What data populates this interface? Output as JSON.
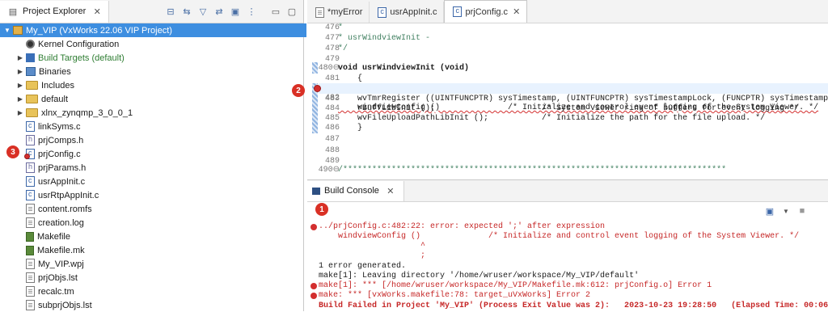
{
  "explorer": {
    "title": "Project Explorer",
    "tree": [
      {
        "label": "My_VIP (VxWorks 22.06 VIP Project)",
        "icon": "project-icon",
        "expanded": true,
        "selected": true
      },
      {
        "label": "Kernel Configuration",
        "icon": "kernel-config-icon"
      },
      {
        "label": "Build Targets (default)",
        "icon": "build-target-icon",
        "green": true
      },
      {
        "label": "Binaries",
        "icon": "binaries-icon"
      },
      {
        "label": "Includes",
        "icon": "includes-icon"
      },
      {
        "label": "default",
        "icon": "folder-icon"
      },
      {
        "label": "xlnx_zynqmp_3_0_0_1",
        "icon": "folder-icon"
      },
      {
        "label": "linkSyms.c",
        "icon": "c-file-icon"
      },
      {
        "label": "prjComps.h",
        "icon": "h-file-icon"
      },
      {
        "label": "prjConfig.c",
        "icon": "c-file-icon",
        "error": true
      },
      {
        "label": "prjParams.h",
        "icon": "h-file-icon"
      },
      {
        "label": "usrAppInit.c",
        "icon": "c-file-icon"
      },
      {
        "label": "usrRtpAppInit.c",
        "icon": "c-file-icon"
      },
      {
        "label": "content.romfs",
        "icon": "file-icon"
      },
      {
        "label": "creation.log",
        "icon": "file-icon"
      },
      {
        "label": "Makefile",
        "icon": "makefile-icon"
      },
      {
        "label": "Makefile.mk",
        "icon": "makefile-icon"
      },
      {
        "label": "My_VIP.wpj",
        "icon": "file-icon"
      },
      {
        "label": "prjObjs.lst",
        "icon": "file-icon"
      },
      {
        "label": "recalc.tm",
        "icon": "file-icon"
      },
      {
        "label": "subprjObjs.lst",
        "icon": "file-icon"
      }
    ]
  },
  "editor": {
    "tabs": [
      {
        "label": "*myError",
        "active": false
      },
      {
        "label": "usrAppInit.c",
        "active": false
      },
      {
        "label": "prjConfig.c",
        "active": true
      }
    ],
    "lines": [
      {
        "num": "476",
        "text": "*"
      },
      {
        "num": "477",
        "text": "* usrWindviewInit -"
      },
      {
        "num": "478",
        "text": "*/"
      },
      {
        "num": "479",
        "text": ""
      },
      {
        "num": "480⊖",
        "text": "void usrWindviewInit (void)"
      },
      {
        "num": "481",
        "text": "    {"
      },
      {
        "num": "482",
        "text": "    windviewConfig ()              /* Initialize and control event logging of the System Viewer. */"
      },
      {
        "num": "483",
        "text": "    wvTmrRegister ((UINTFUNCPTR) sysTimestamp, (UINTFUNCPTR) sysTimestampLock, (FUNCPTR) sysTimestampEn"
      },
      {
        "num": "484",
        "text": "    rBuffLibInit ();                      /* System Viewer ring of buffers for event logging */"
      },
      {
        "num": "485",
        "text": "    wvFileUploadPathLibInit ();           /* Initialize the path for the file upload. */"
      },
      {
        "num": "486",
        "text": "    }"
      },
      {
        "num": "487",
        "text": ""
      },
      {
        "num": "488",
        "text": ""
      },
      {
        "num": "489",
        "text": ""
      },
      {
        "num": "490⊖",
        "text": "/*******************************************************************************"
      }
    ]
  },
  "console": {
    "title": "Build Console",
    "lines": [
      {
        "text": "../prjConfig.c:482:22: error: expected ';' after expression",
        "style": "err",
        "icon": true
      },
      {
        "text": "    windviewConfig ()              /* Initialize and control event logging of the System Viewer. */",
        "style": "err"
      },
      {
        "text": "                     ^",
        "style": "err"
      },
      {
        "text": "                     ;",
        "style": "err"
      },
      {
        "text": "1 error generated.",
        "style": "normal"
      },
      {
        "text": "make[1]: Leaving directory '/home/wruser/workspace/My_VIP/default'",
        "style": "normal"
      },
      {
        "text": "make[1]: *** [/home/wruser/workspace/My_VIP/Makefile.mk:612: prjConfig.o] Error 1",
        "style": "err",
        "icon": true
      },
      {
        "text": "make: *** [vxWorks.makefile:78: target_uVxWorks] Error 2",
        "style": "err",
        "icon": true
      },
      {
        "text": "Build Failed in Project 'My_VIP' (Process Exit Value was 2):   2023-10-23 19:28:50   (Elapsed Time: 00:06)",
        "style": "bold"
      }
    ]
  },
  "badges": {
    "one": "1",
    "two": "2",
    "three": "3"
  },
  "colors": {
    "accent": "#3d8ee0",
    "error": "#d93025",
    "comment": "#3f7f5f"
  }
}
